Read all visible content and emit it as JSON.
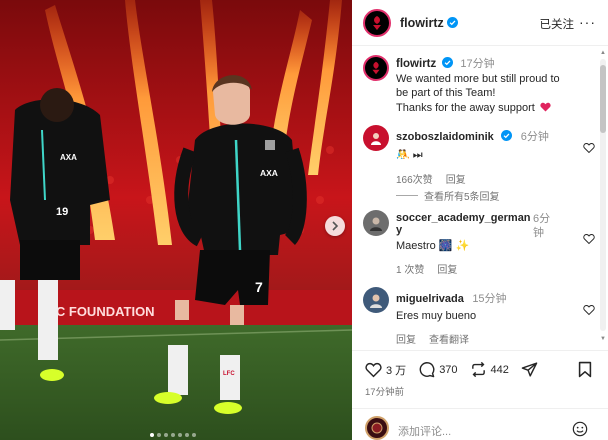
{
  "post": {
    "username": "flowirtz",
    "follow_status": "已关注",
    "more": "···",
    "caption": {
      "time": "17分钟",
      "lines": [
        "We wanted more but still proud to",
        "be part of this Team!",
        "Thanks for the away support"
      ]
    }
  },
  "comments": [
    {
      "username": "szoboszlaidominik",
      "time": "6分钟",
      "text": "🤼 ⏭",
      "likes": "166次赞",
      "reply": "回复",
      "view_replies": "查看所有5条回复"
    },
    {
      "username_line1": "soccer_academy_german",
      "username_line2": "y",
      "time_line1": "6分",
      "time_line2": "钟",
      "text": "Maestro 🎆 ✨",
      "likes": "1 次赞",
      "reply": "回复"
    },
    {
      "username": "miguelrivada",
      "time": "15分钟",
      "text": "Eres muy bueno",
      "reply": "回复",
      "translate": "查看翻译"
    }
  ],
  "actions": {
    "likes": "3 万",
    "comments": "370",
    "reposts": "442",
    "posted_ago": "17分钟前"
  },
  "add_comment": {
    "placeholder": "添加评论..."
  },
  "photo": {
    "shirt_text": "AXA",
    "badge_text": "LFC",
    "number_left": "19",
    "number_right": "7",
    "banner_text": "LFC  FOUNDATION"
  },
  "colors": {
    "accent_blue": "#0095f6",
    "heart_red": "#ed4956",
    "ring": "#e1306c"
  }
}
